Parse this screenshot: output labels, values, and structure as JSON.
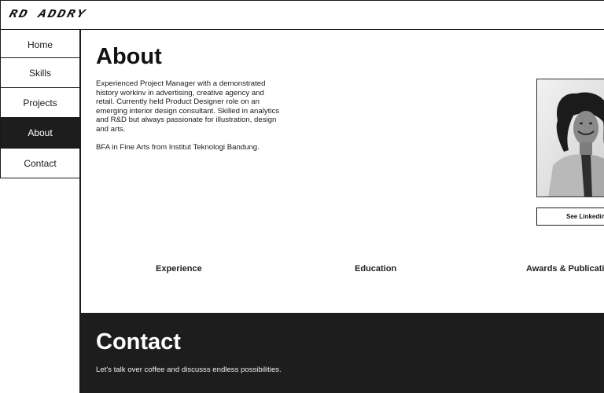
{
  "header": {
    "logo_text": "RD ADDRY"
  },
  "nav": {
    "items": [
      {
        "label": "Home"
      },
      {
        "label": "Skills"
      },
      {
        "label": "Projects"
      },
      {
        "label": "About"
      },
      {
        "label": "Contact"
      }
    ],
    "active": "About"
  },
  "about": {
    "title": "About",
    "bio": "Experienced Project Manager with a demonstrated history workinv in advertising, creative agency and retail. Currently held Product Designer role on an emerging interior design consultant. Skilled in analytics and R&D but always passionate for illustration, design and arts.",
    "education": "BFA in Fine Arts from Institut Teknologi Bandung.",
    "linkedin_label": "See Linkedin"
  },
  "tabs": [
    {
      "label": "Experience"
    },
    {
      "label": "Education"
    },
    {
      "label": "Awards & Publications"
    }
  ],
  "contact": {
    "title": "Contact",
    "text": "Let's talk over coffee and discusss endless possibilities."
  },
  "colors": {
    "dark": "#1d1d1d",
    "light": "#ffffff",
    "border": "#1a1a1a"
  }
}
